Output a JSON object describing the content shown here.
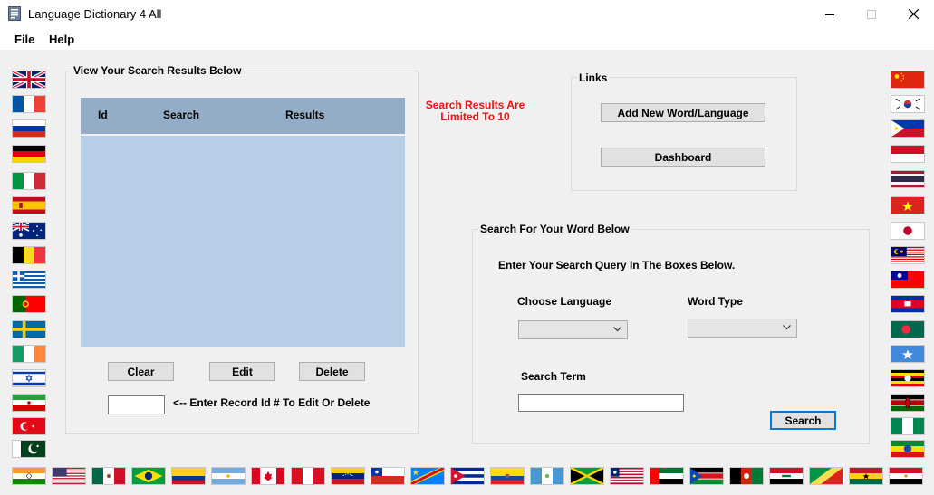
{
  "window": {
    "title": "Language Dictionary 4 All"
  },
  "menu": {
    "file": "File",
    "help": "Help"
  },
  "results": {
    "group_title": "View Your Search Results Below",
    "columns": [
      "Id",
      "Search",
      "Results"
    ],
    "limit_note": "Search Results Are Limited To 10",
    "clear_label": "Clear",
    "edit_label": "Edit",
    "delete_label": "Delete",
    "record_id_value": "",
    "record_hint": "<-- Enter Record Id # To Edit Or Delete"
  },
  "links": {
    "group_title": "Links",
    "add_label": "Add New Word/Language",
    "dashboard_label": "Dashboard"
  },
  "search": {
    "group_title": "Search For Your Word Below",
    "instruction": "Enter Your Search Query In The Boxes Below.",
    "language_label": "Choose Language",
    "language_value": "",
    "word_type_label": "Word Type",
    "word_type_value": "",
    "term_label": "Search Term",
    "term_value": "",
    "search_label": "Search"
  },
  "colors": {
    "accent": "#0078d7",
    "grid_header": "#93adc6",
    "grid_body": "#b8cfe8",
    "note": "#ee1111"
  },
  "flags": {
    "left": [
      "uk",
      "france",
      "russia",
      "germany",
      "italy",
      "spain",
      "australia",
      "belgium",
      "greece",
      "portugal",
      "sweden",
      "ireland",
      "israel",
      "iran",
      "turkey",
      "pakistan"
    ],
    "right": [
      "china",
      "south-korea",
      "philippines",
      "indonesia",
      "thailand",
      "vietnam",
      "japan",
      "malaysia",
      "taiwan",
      "cambodia",
      "bangladesh",
      "somalia",
      "uganda",
      "kenya",
      "nigeria",
      "ethiopia"
    ],
    "bottom": [
      "india",
      "usa",
      "mexico",
      "brazil",
      "colombia",
      "argentina",
      "canada",
      "peru",
      "venezuela",
      "chile",
      "dr-congo",
      "cuba",
      "ecuador",
      "guatemala",
      "jamaica",
      "liberia",
      "uae",
      "south-sudan",
      "afghanistan",
      "iraq",
      "congo",
      "ghana",
      "egypt"
    ]
  }
}
